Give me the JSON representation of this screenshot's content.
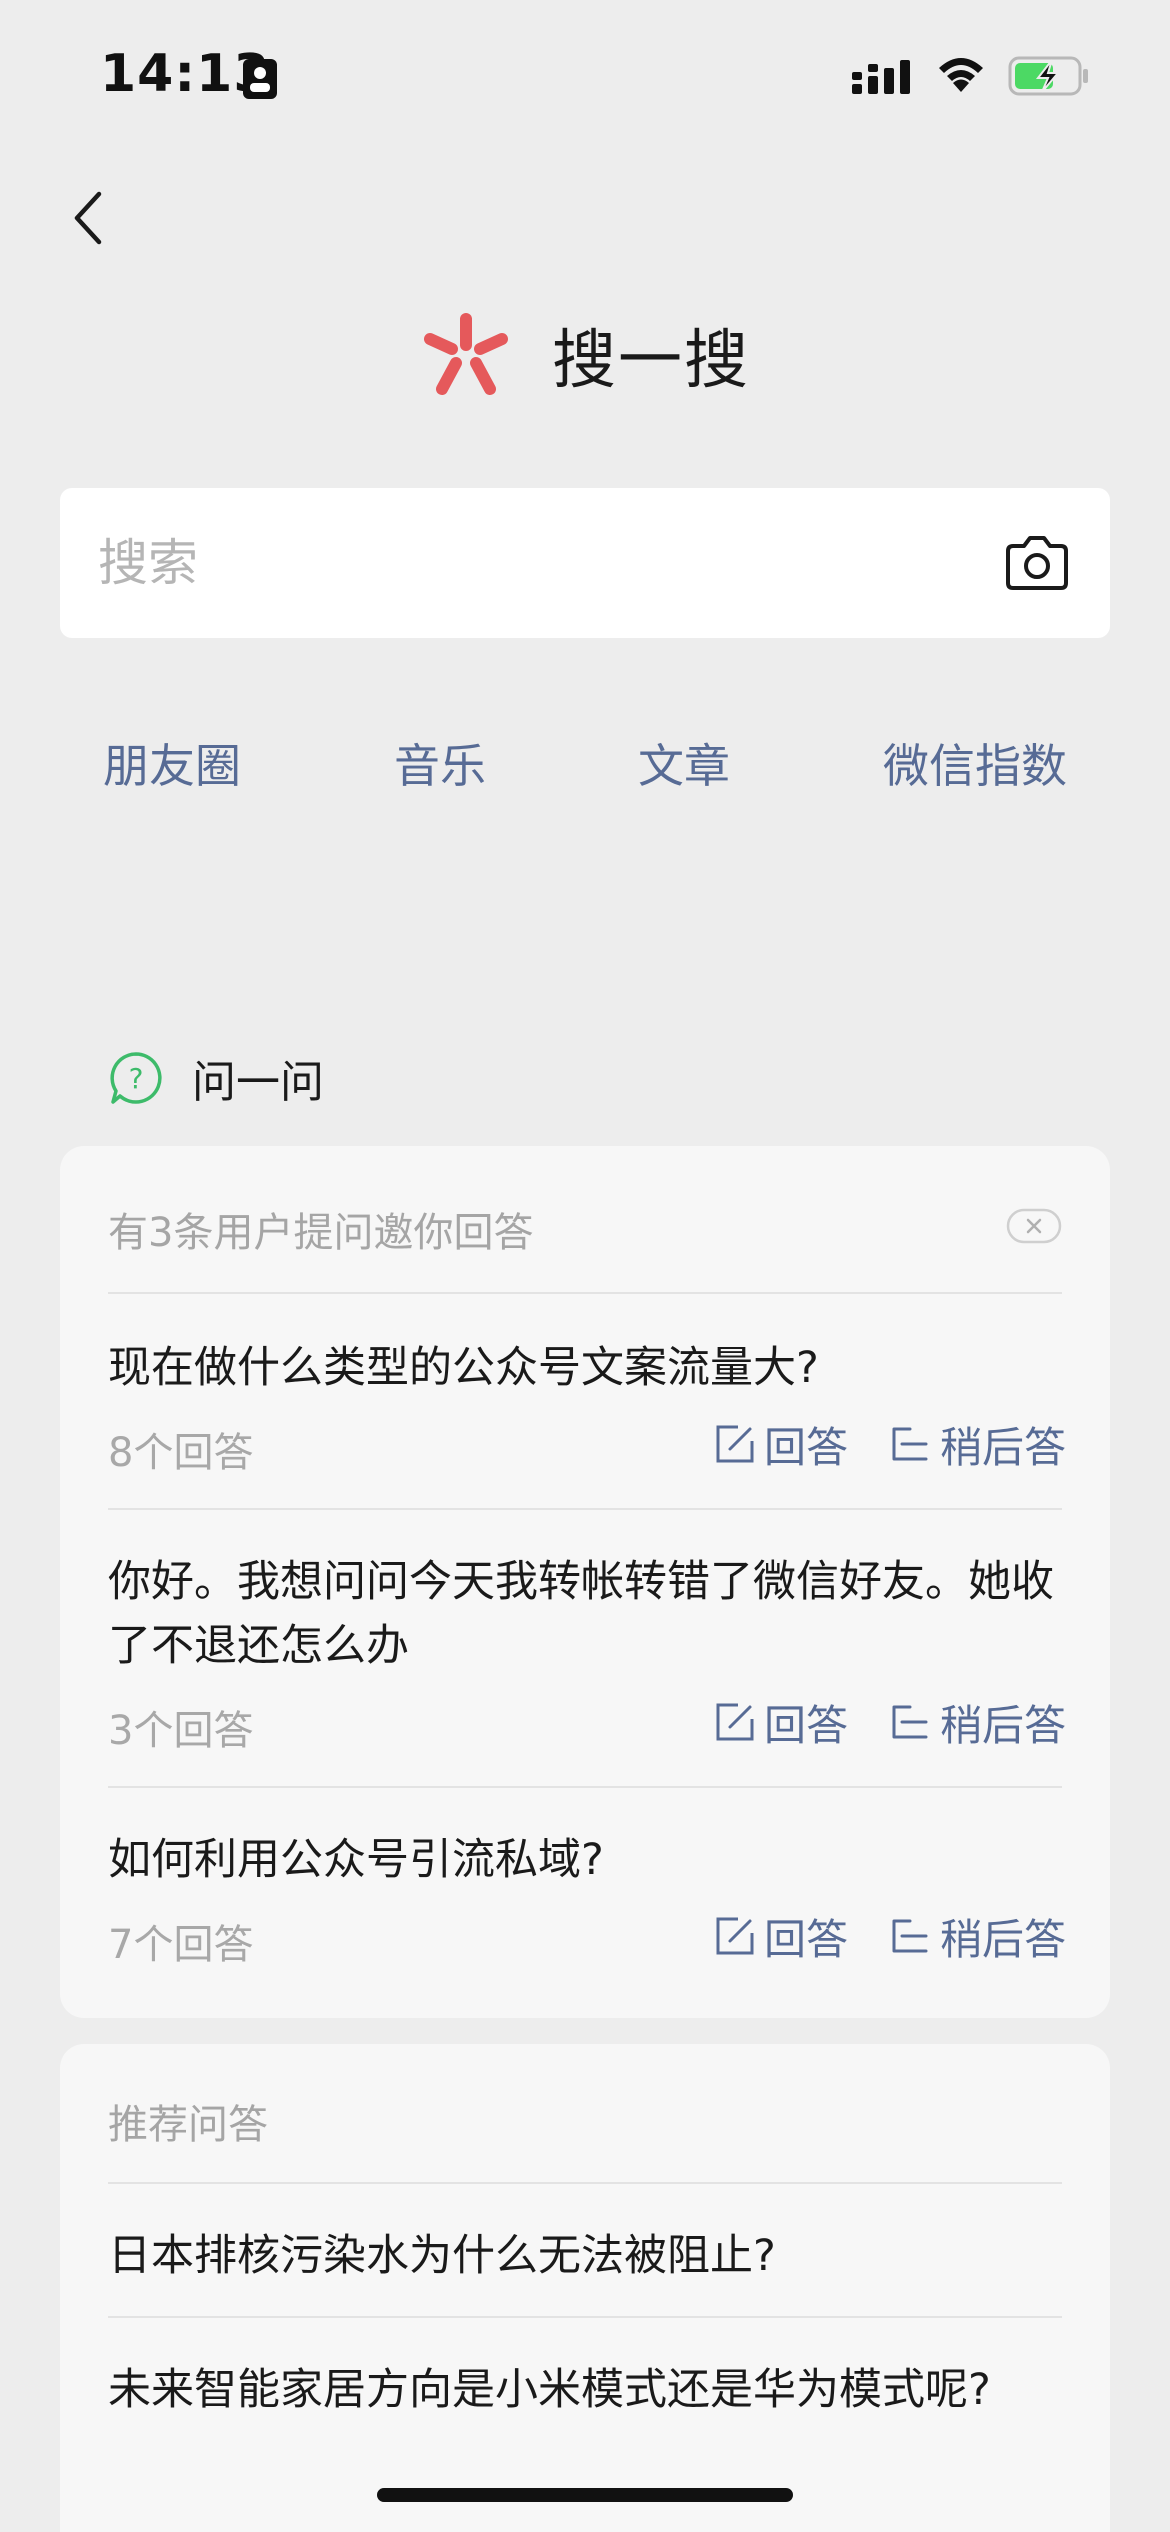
{
  "status_bar": {
    "time": "14:13"
  },
  "header": {
    "title": "搜一搜"
  },
  "search": {
    "placeholder": "搜索"
  },
  "quick_links": [
    "朋友圈",
    "音乐",
    "文章",
    "微信指数"
  ],
  "ask": {
    "section_title": "问一问",
    "invite_text": "有3条用户提问邀你回答",
    "answer_label": "回答",
    "later_label": "稍后答",
    "questions": [
      {
        "title": "现在做什么类型的公众号文案流量大?",
        "count": "8个回答"
      },
      {
        "title": "你好。我想问问今天我转帐转错了微信好友。她收了不退还怎么办",
        "count": "3个回答"
      },
      {
        "title": "如何利用公众号引流私域?",
        "count": "7个回答"
      }
    ]
  },
  "recommended": {
    "title": "推荐问答",
    "items": [
      "日本排核污染水为什么无法被阻止?",
      "未来智能家居方向是小米模式还是华为模式呢?"
    ]
  },
  "colors": {
    "link": "#576B95",
    "logo": "#E5595B",
    "ask_icon": "#3DBB6A",
    "background": "#EDEDED"
  }
}
